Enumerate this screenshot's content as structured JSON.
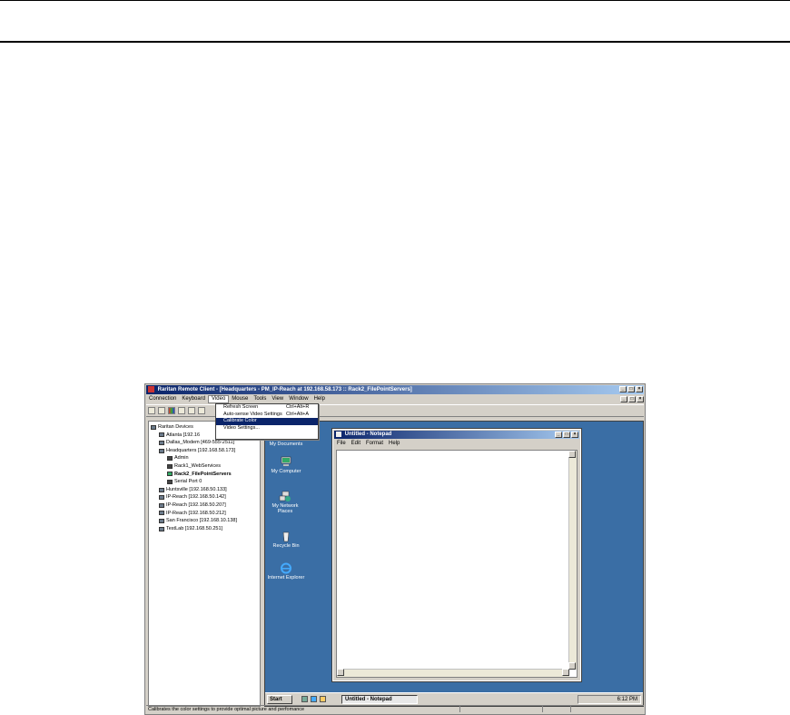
{
  "window": {
    "title": "Raritan Remote Client - [Headquarters - PM_IP-Reach at 192.168.58.173 :: Rack2_FilePointServers]",
    "min": "_",
    "max": "□",
    "close": "×"
  },
  "menubar": [
    "Connection",
    "Keyboard",
    "Video",
    "Mouse",
    "Tools",
    "View",
    "Window",
    "Help"
  ],
  "active_menu": "Video",
  "video_menu": {
    "items": [
      {
        "label": "Refresh Screen",
        "shortcut": "Ctrl+Alt+R"
      },
      {
        "label": "Auto-sense Video Settings",
        "shortcut": "Ctrl+Alt+A"
      },
      {
        "label": "Calibrate Color",
        "shortcut": ""
      },
      {
        "label": "Video Settings...",
        "shortcut": ""
      }
    ],
    "highlighted": "Calibrate Color"
  },
  "tree": {
    "items": [
      {
        "label": "Raritan Devices",
        "indent": 0,
        "kind": "root",
        "bold": false
      },
      {
        "label": "Atlanta [192.16",
        "indent": 1,
        "kind": "device",
        "bold": false
      },
      {
        "label": "Dallas_Modem [469-555-2511]",
        "indent": 1,
        "kind": "device",
        "bold": false
      },
      {
        "label": "Headquarters [192.168.58.173]",
        "indent": 1,
        "kind": "device",
        "bold": false
      },
      {
        "label": "Admin",
        "indent": 2,
        "kind": "port",
        "bold": false
      },
      {
        "label": "Rack1_WebServices",
        "indent": 2,
        "kind": "port",
        "bold": false
      },
      {
        "label": "Rack2_FilePointServers",
        "indent": 2,
        "kind": "sel",
        "bold": true
      },
      {
        "label": "Serial Port 0",
        "indent": 2,
        "kind": "port",
        "bold": false
      },
      {
        "label": "Huntsville [192.168.50.133]",
        "indent": 1,
        "kind": "device",
        "bold": false
      },
      {
        "label": "IP-Reach [192.168.50.142]",
        "indent": 1,
        "kind": "device",
        "bold": false
      },
      {
        "label": "IP-Reach [192.168.50.207]",
        "indent": 1,
        "kind": "device",
        "bold": false
      },
      {
        "label": "IP-Reach [192.168.50.212]",
        "indent": 1,
        "kind": "device",
        "bold": false
      },
      {
        "label": "San Francisco [192.168.10.138]",
        "indent": 1,
        "kind": "device",
        "bold": false
      },
      {
        "label": "TestLab [192.168.50.251]",
        "indent": 1,
        "kind": "device",
        "bold": false
      }
    ]
  },
  "desktop": {
    "icons": [
      "My Documents",
      "My Computer",
      "My Network Places",
      "Recycle Bin",
      "Internet Explorer"
    ]
  },
  "notepad": {
    "title": "Untitled - Notepad",
    "menu": [
      "File",
      "Edit",
      "Format",
      "Help"
    ]
  },
  "taskbar": {
    "start": "Start",
    "task": "Untitled - Notepad",
    "clock": "6:12 PM"
  },
  "statusbar": {
    "text": "Calibrates the color settings to provide optimal picture and perfomance"
  }
}
